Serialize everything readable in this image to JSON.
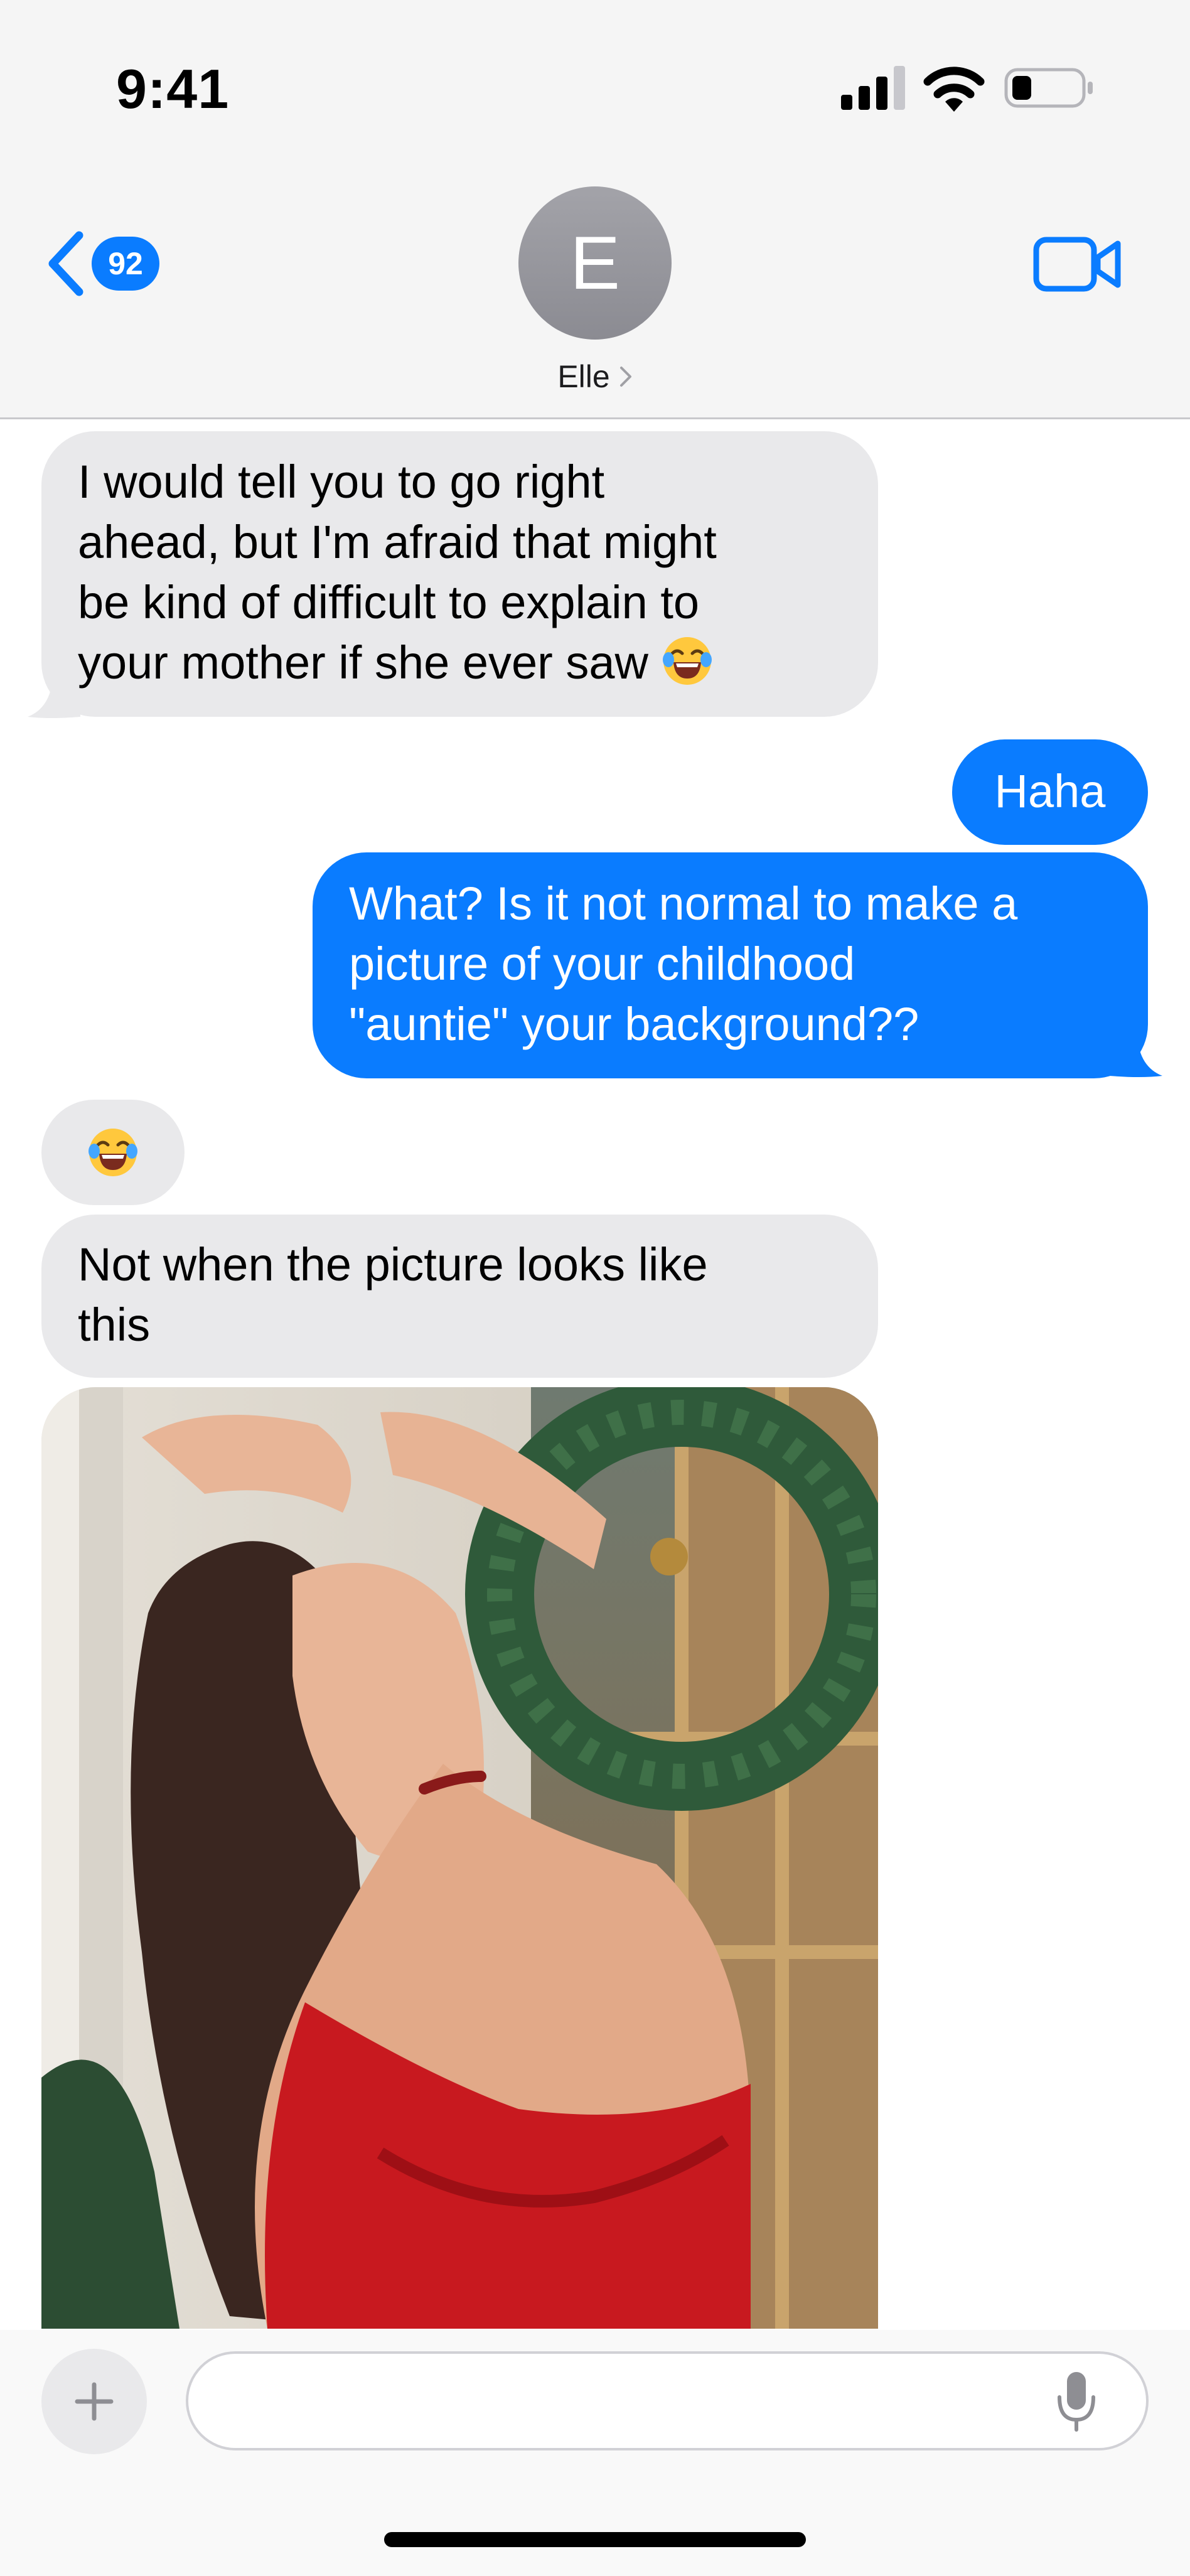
{
  "status_bar": {
    "time": "9:41",
    "icons": [
      "cellular-signal-icon",
      "wifi-icon",
      "battery-icon"
    ]
  },
  "header": {
    "back_badge_count": "92",
    "avatar_initial": "E",
    "contact_name": "Elle",
    "icons": [
      "chevron-left-icon",
      "chevron-right-icon",
      "video-camera-icon"
    ],
    "accent_color": "#0a7cff"
  },
  "messages": [
    {
      "direction": "incoming",
      "lines": [
        "I would tell you to go right",
        "ahead, but I'm afraid that might",
        "be kind of difficult to explain to",
        "your mother if she ever saw"
      ],
      "emoji": "laughing-tears-emoji"
    },
    {
      "direction": "outgoing",
      "text": "Haha"
    },
    {
      "direction": "outgoing",
      "lines": [
        "What? Is it not normal to make a",
        "picture of your childhood",
        "\"auntie\" your background??"
      ]
    },
    {
      "direction": "incoming",
      "emoji": "laughing-tears-emoji"
    },
    {
      "direction": "incoming",
      "lines": [
        "Not when the picture looks like",
        "this"
      ]
    },
    {
      "direction": "incoming",
      "type": "image"
    }
  ],
  "colors": {
    "incoming_bubble": "#e9e9eb",
    "outgoing_bubble": "#0a7cff",
    "header_background": "#f5f5f5"
  },
  "composer": {
    "placeholder": "",
    "icons": [
      "plus-icon",
      "microphone-icon"
    ]
  }
}
